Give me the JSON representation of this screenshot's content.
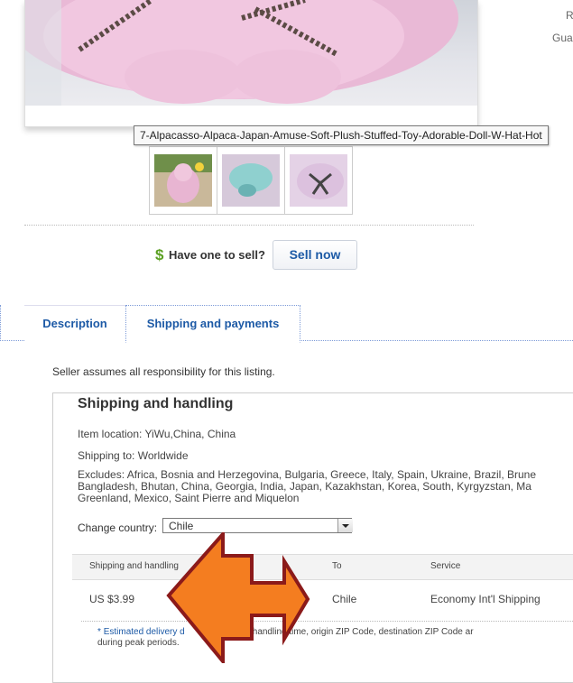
{
  "right_fragments": {
    "r": "R",
    "gua": "Gua"
  },
  "tooltip": "7-Alpacasso-Alpaca-Japan-Amuse-Soft-Plush-Stuffed-Toy-Adorable-Doll-W-Hat-Hot",
  "sell": {
    "dollar": "$",
    "prompt": "Have one to sell?",
    "button": "Sell now"
  },
  "tabs": [
    {
      "label": "Description"
    },
    {
      "label": "Shipping and payments"
    }
  ],
  "seller_note": "Seller assumes all responsibility for this listing.",
  "shipping": {
    "title": "Shipping and handling",
    "item_location": "Item location: YiWu,China, China",
    "shipping_to": "Shipping to: Worldwide",
    "excludes_line1": "Excludes: Africa, Bosnia and Herzegovina, Bulgaria, Greece, Italy, Spain, Ukraine, Brazil, Brune",
    "excludes_line2": "Bangladesh, Bhutan, China, Georgia, India, Japan, Kazakhstan, Korea, South, Kyrgyzstan, Ma",
    "excludes_line3": "Greenland, Mexico, Saint Pierre and Miquelon",
    "change_country_label": "Change country:",
    "country_value": "Chile",
    "table": {
      "headers": [
        "Shipping and handling",
        "To",
        "Service"
      ],
      "row": {
        "cost": "US $3.99",
        "to": "Chile",
        "service": "Economy Int'l Shipping"
      }
    },
    "estimated_star": "*",
    "estimated_link": "Estimated delivery d",
    "estimated_rest": "r's handling time, origin ZIP Code, destination ZIP Code ar",
    "estimated_line2": "during peak periods."
  },
  "colors": {
    "link_blue": "#1d5aa6",
    "arrow_orange": "#f47d20",
    "arrow_outline": "#8b1a1a",
    "dollar_green": "#5ba022"
  }
}
